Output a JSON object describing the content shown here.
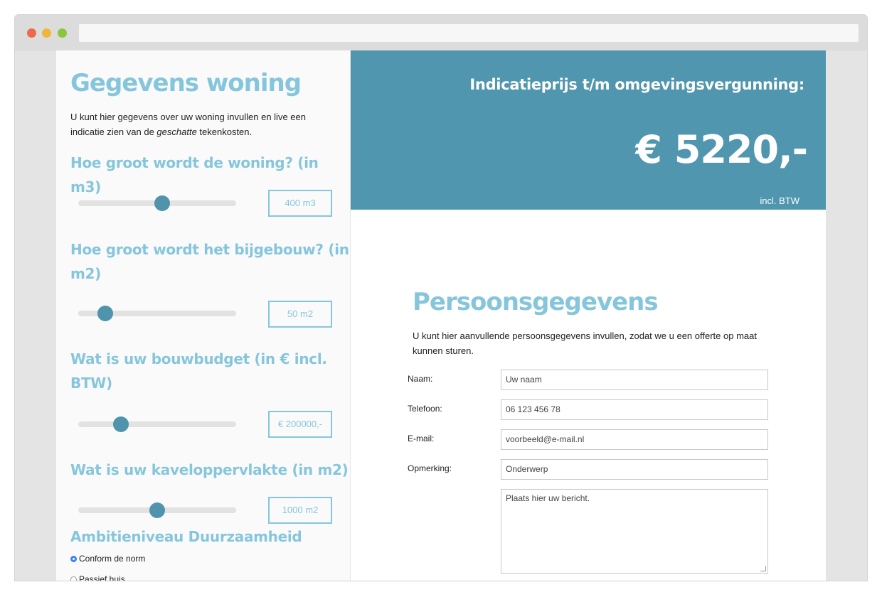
{
  "left": {
    "title": "Gegevens woning",
    "intro_before": "U kunt hier gegevens over uw woning invullen en live een indicatie zien van de ",
    "intro_em": "geschatte",
    "intro_after": " tekenkosten.",
    "sliders": [
      {
        "label_l1": "Hoe groot wordt de woning? (in m3)",
        "label_l2": "",
        "value": "400 m3",
        "level": 0.53
      },
      {
        "label_l1": "Hoe groot wordt het bijgebouw? (in",
        "label_l2": "m2)",
        "value": "50 m2",
        "level": 0.17
      },
      {
        "label_l1": "Wat is uw bouwbudget (in € incl.",
        "label_l2": "BTW)",
        "value": "€ 200000,-",
        "level": 0.27
      },
      {
        "label_l1": "Wat is uw kaveloppervlakte (in m2)",
        "label_l2": "",
        "value": "1000 m2",
        "level": 0.5
      }
    ],
    "ambition_title": "Ambitieniveau Duurzaamheid",
    "options": [
      {
        "label": "Conform de norm",
        "checked": true
      },
      {
        "label": "Passief huis",
        "checked": false
      }
    ]
  },
  "price": {
    "title": "Indicatieprijs t/m omgevingsvergunning:",
    "value": "€ 5220,-",
    "note": "incl. BTW"
  },
  "personal": {
    "title": "Persoonsgegevens",
    "intro": "U kunt hier aanvullende persoonsgegevens invullen, zodat we u een offerte op maat kunnen sturen.",
    "fields": [
      {
        "label": "Naam:",
        "value": "Uw naam"
      },
      {
        "label": "Telefoon:",
        "value": "06 123 456 78"
      },
      {
        "label": "E-mail:",
        "value": "voorbeeld@e-mail.nl"
      },
      {
        "label": "Opmerking:",
        "value": "Onderwerp"
      }
    ],
    "message_placeholder": "Plaats hier uw bericht."
  }
}
